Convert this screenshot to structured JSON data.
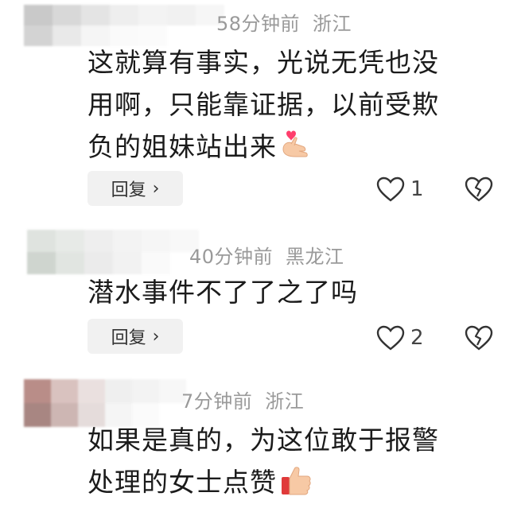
{
  "comments": [
    {
      "time": "58分钟前",
      "location": "浙江",
      "text_lines": [
        "这就算有事实，光说无凭也没",
        "用啊，只能靠证据，以前受欺",
        "负的姐妹站出来"
      ],
      "emoji": "heart-hands-emoji",
      "reply_label": "回复",
      "like_count": "1"
    },
    {
      "time": "40分钟前",
      "location": "黑龙江",
      "text_lines": [
        "潜水事件不了了之了吗"
      ],
      "emoji": "",
      "reply_label": "回复",
      "like_count": "2"
    },
    {
      "time": "7分钟前",
      "location": "浙江",
      "text_lines": [
        "如果是真的，为这位敢于报警",
        "处理的女士点赞"
      ],
      "emoji": "thumbs-up-emoji",
      "reply_label": "回复",
      "like_count": ""
    }
  ],
  "icons": {
    "reply_chevron": "chevron-right-icon",
    "like": "heart-outline-icon",
    "dislike": "broken-heart-icon"
  },
  "colors": {
    "meta_text": "#9a9a9a",
    "body_text": "#1b1b1b",
    "reply_bg": "#f1f1f1",
    "emoji_heart": "#ff3e6c",
    "emoji_skin": "#f7c9a5"
  }
}
